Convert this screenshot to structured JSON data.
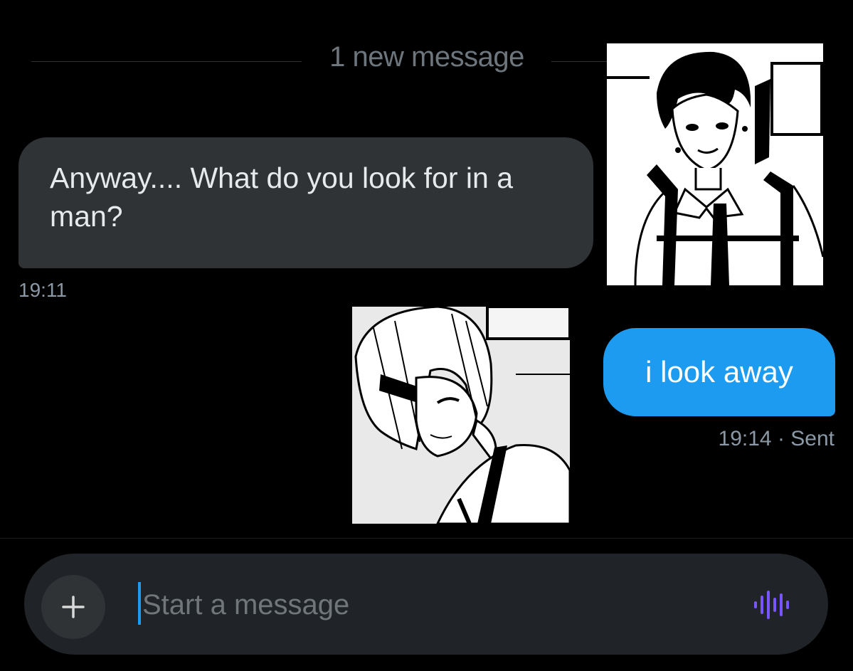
{
  "timeline": {
    "new_message_divider": "1 new message"
  },
  "messages": [
    {
      "direction": "incoming",
      "text": "Anyway.... What do you look for in a man?",
      "time": "19:11"
    },
    {
      "direction": "outgoing",
      "text": "i look away",
      "time": "19:14",
      "status": "· Sent"
    }
  ],
  "overlays": [
    {
      "name": "manga-panel-dark-haired-man",
      "icon": "manga-illustration"
    },
    {
      "name": "manga-panel-light-haired-woman",
      "icon": "manga-illustration"
    }
  ],
  "composer": {
    "placeholder": "Start a message",
    "value": "",
    "add_icon": "plus-icon",
    "voice_icon": "voice-waveform-icon"
  },
  "colors": {
    "background": "#000000",
    "incoming_bubble": "#2f3336",
    "outgoing_bubble": "#1d9bf0",
    "composer": "#202327",
    "voice_icon": "#7856ff"
  }
}
